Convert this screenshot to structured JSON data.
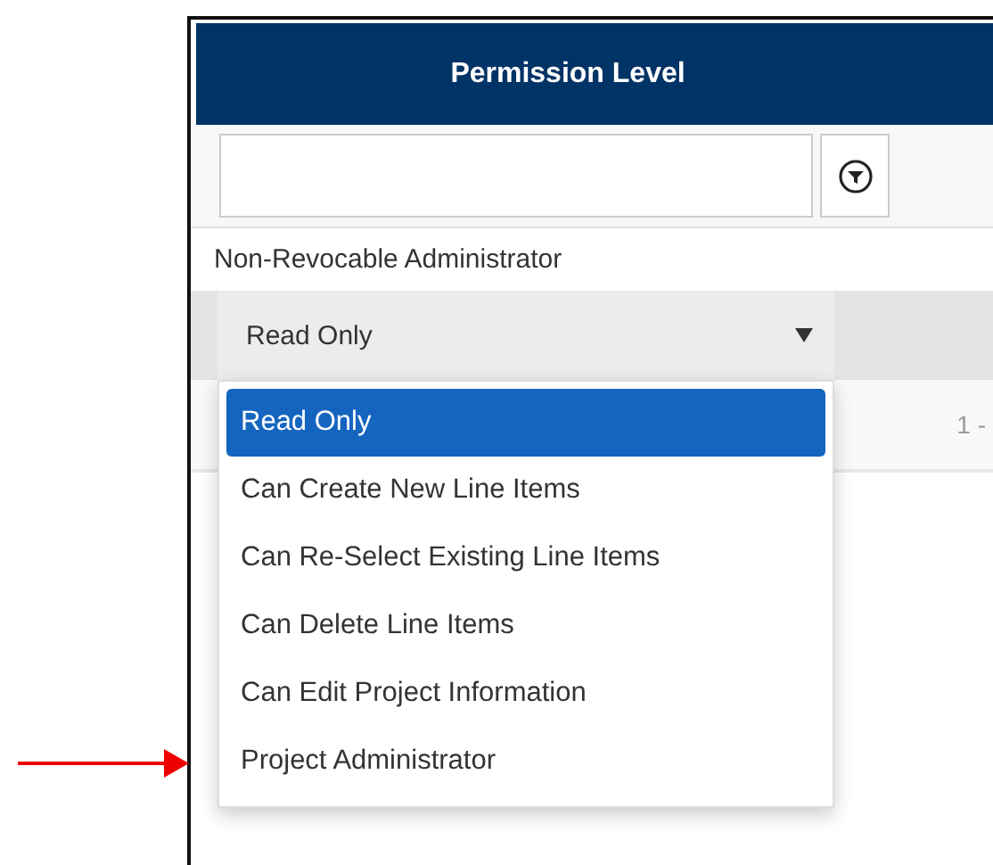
{
  "column_header": "Permission Level",
  "row_text": "Non-Revocable Administrator",
  "dropdown": {
    "value": "Read Only",
    "expanded": true
  },
  "pager_text": "1 -",
  "options": [
    {
      "label": "Read Only",
      "selected": true,
      "annotated": false
    },
    {
      "label": "Can Create New Line Items",
      "selected": false,
      "annotated": false
    },
    {
      "label": "Can Re-Select Existing Line Items",
      "selected": false,
      "annotated": false
    },
    {
      "label": "Can Delete Line Items",
      "selected": false,
      "annotated": false
    },
    {
      "label": "Can Edit Project Information",
      "selected": false,
      "annotated": false
    },
    {
      "label": "Project Administrator",
      "selected": false,
      "annotated": true
    }
  ]
}
